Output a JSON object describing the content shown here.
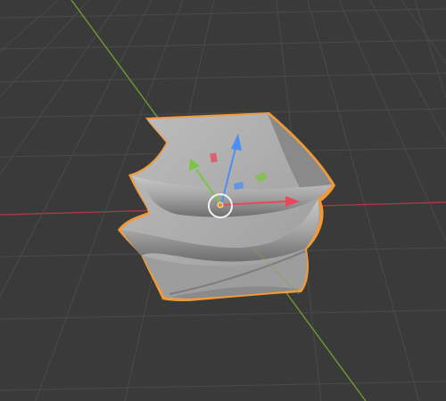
{
  "viewport": {
    "mode": "3d-viewport",
    "background_color": "#3a3a3a",
    "grid_color": "#4b4b4b",
    "x_axis_color": "#a33b45",
    "y_axis_color": "#6f9a2e"
  },
  "object": {
    "shape": "twisted-mesh",
    "selected": true,
    "outline_color": "#f29a38",
    "surface_color": "#a9a9a9"
  },
  "gizmo": {
    "type": "translate",
    "x_color": "#e8485a",
    "y_color": "#7bc542",
    "z_color": "#4c8ef5",
    "origin_color": "#f28c1e"
  }
}
